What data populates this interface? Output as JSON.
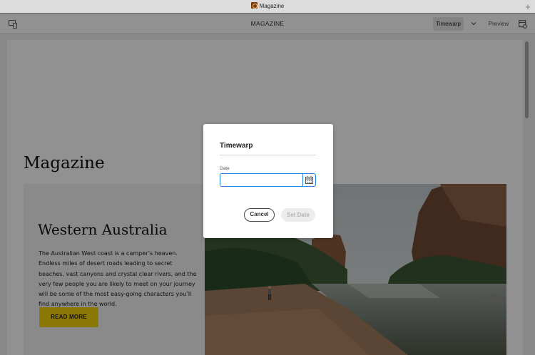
{
  "browser": {
    "tab_title": "Magazine",
    "new_tab": "+"
  },
  "header": {
    "title": "MAGAZINE",
    "timewarp_label": "Timewarp",
    "preview_label": "Preview"
  },
  "page": {
    "title": "Magazine",
    "teaser": {
      "heading": "Western Australia",
      "body": "The Australian West coast is a camper’s heaven. Endless miles of desert roads leading to secret beaches, vast canyons and crystal clear rivers, and the very few people you are likely to meet on your journey will be some of the most easy-going characters you’ll find anywhere in the world.",
      "button_label": "READ MORE"
    }
  },
  "dialog": {
    "title": "Timewarp",
    "date_label": "Date",
    "date_value": "",
    "cancel_label": "Cancel",
    "set_date_label": "Set Date"
  },
  "colors": {
    "accent_blue": "#2680eb",
    "button_yellow": "#f4d40d",
    "overlay": "rgba(0,0,0,0.43)"
  },
  "icons": [
    "favicon-icon",
    "emulator-icon",
    "chevron-down-icon",
    "page-properties-icon",
    "calendar-icon"
  ]
}
